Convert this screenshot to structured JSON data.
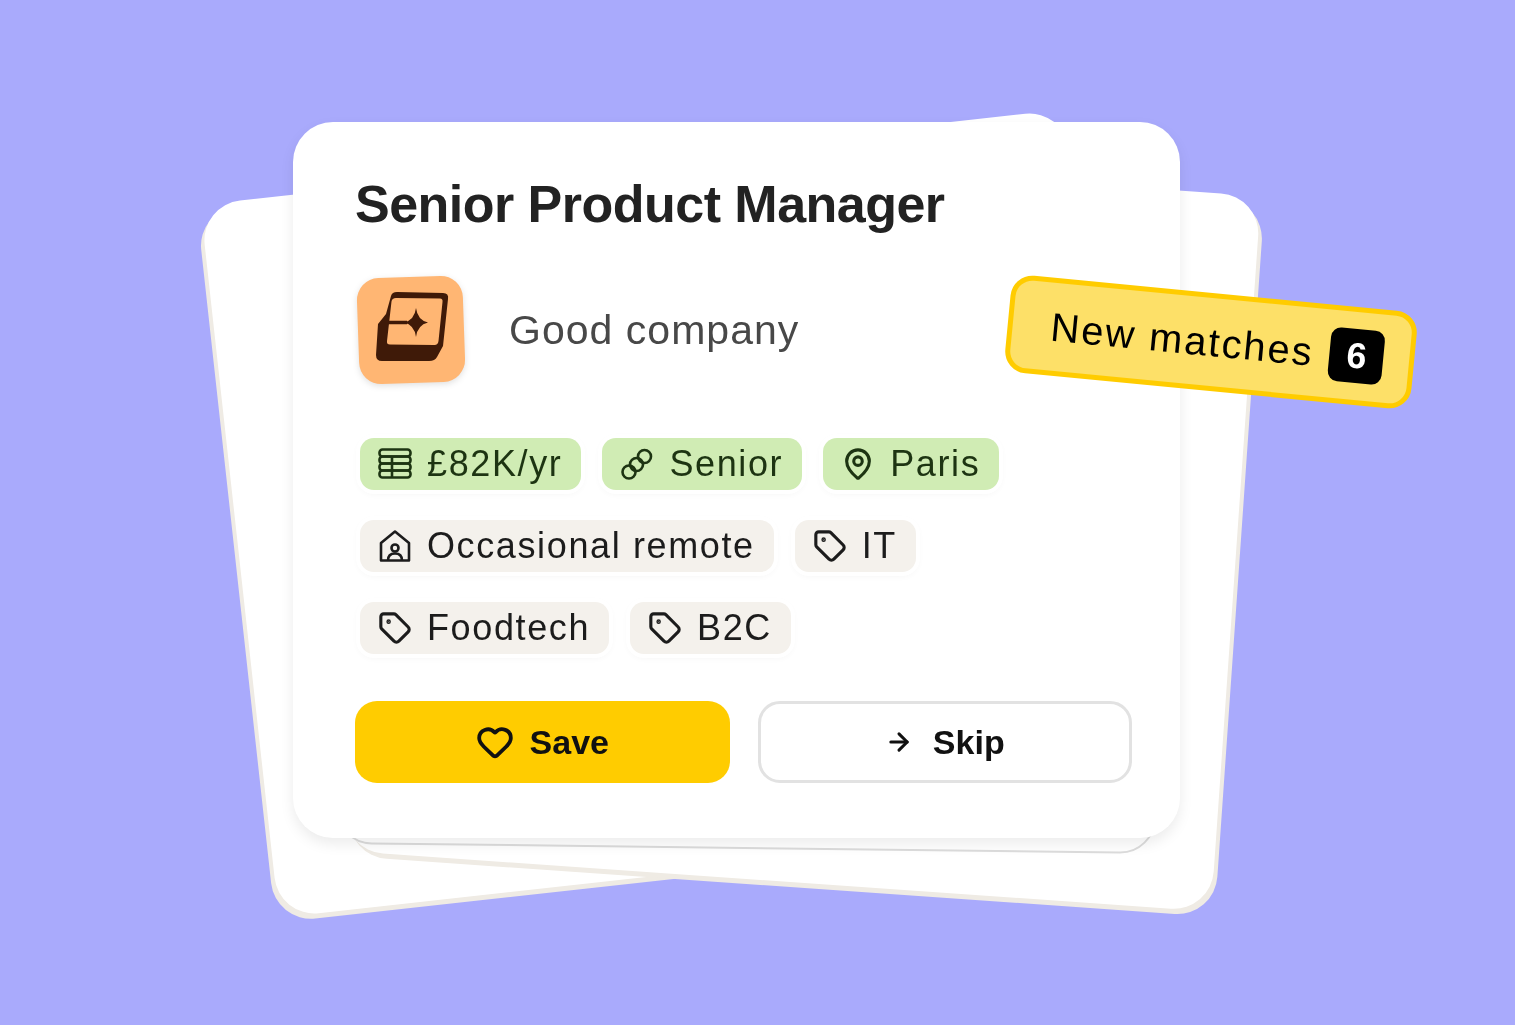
{
  "job": {
    "title": "Senior Product Manager",
    "company": "Good company"
  },
  "tag_rows": [
    {
      "tags": [
        {
          "label": "£82K/yr",
          "kind": "salary",
          "matched": true
        },
        {
          "label": "Senior",
          "kind": "seniority",
          "matched": true
        },
        {
          "label": "Paris",
          "kind": "location",
          "matched": true
        }
      ]
    },
    {
      "tags": [
        {
          "label": "Occasional remote",
          "kind": "remote",
          "matched": false
        },
        {
          "label": "IT",
          "kind": "tag",
          "matched": false
        }
      ]
    },
    {
      "tags": [
        {
          "label": "Foodtech",
          "kind": "tag",
          "matched": false
        },
        {
          "label": "B2C",
          "kind": "tag",
          "matched": false
        }
      ]
    }
  ],
  "buttons": [
    {
      "label": "Save",
      "kind": "primary"
    },
    {
      "label": "Skip",
      "kind": "secondary"
    }
  ],
  "badge": {
    "label": "New matches",
    "count": "6"
  }
}
